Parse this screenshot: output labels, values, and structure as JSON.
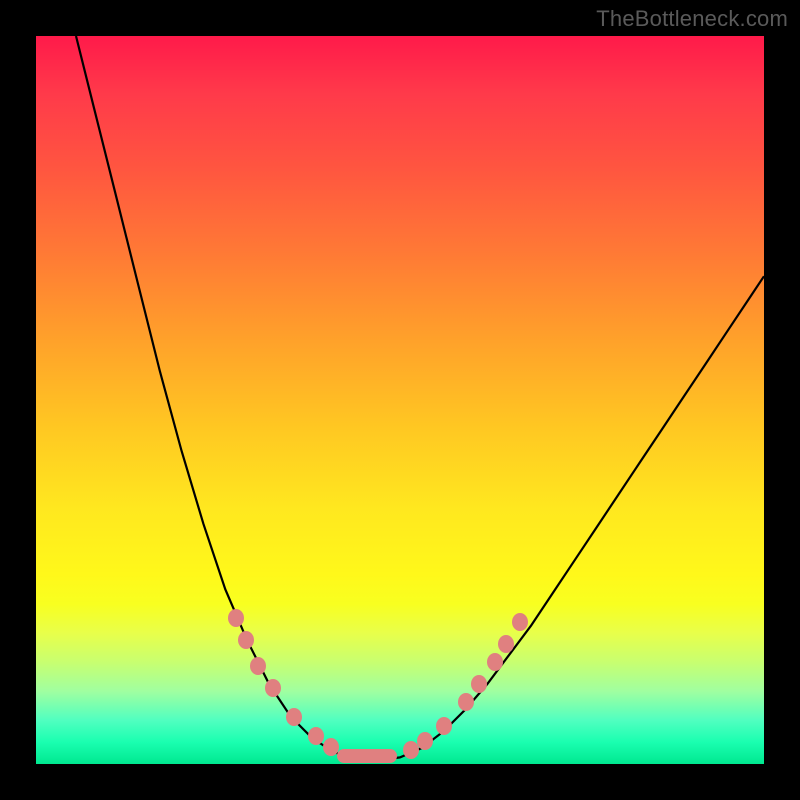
{
  "watermark": "TheBottleneck.com",
  "chart_data": {
    "type": "line",
    "title": "",
    "xlabel": "",
    "ylabel": "",
    "xlim": [
      0,
      100
    ],
    "ylim": [
      0,
      100
    ],
    "curve_points": [
      {
        "x": 5.5,
        "y": 100
      },
      {
        "x": 8,
        "y": 90
      },
      {
        "x": 11,
        "y": 78
      },
      {
        "x": 14,
        "y": 66
      },
      {
        "x": 17,
        "y": 54
      },
      {
        "x": 20,
        "y": 43
      },
      {
        "x": 23,
        "y": 33
      },
      {
        "x": 26,
        "y": 24
      },
      {
        "x": 29,
        "y": 17
      },
      {
        "x": 32,
        "y": 11
      },
      {
        "x": 35,
        "y": 6.5
      },
      {
        "x": 38,
        "y": 3.5
      },
      {
        "x": 41,
        "y": 1.6
      },
      {
        "x": 44,
        "y": 0.7
      },
      {
        "x": 47,
        "y": 0.5
      },
      {
        "x": 50,
        "y": 0.9
      },
      {
        "x": 53,
        "y": 2.2
      },
      {
        "x": 56,
        "y": 4.5
      },
      {
        "x": 59,
        "y": 7.5
      },
      {
        "x": 62,
        "y": 11
      },
      {
        "x": 65,
        "y": 15
      },
      {
        "x": 68,
        "y": 19
      },
      {
        "x": 71,
        "y": 23.5
      },
      {
        "x": 74,
        "y": 28
      },
      {
        "x": 77,
        "y": 32.5
      },
      {
        "x": 80,
        "y": 37
      },
      {
        "x": 83,
        "y": 41.5
      },
      {
        "x": 86,
        "y": 46
      },
      {
        "x": 89,
        "y": 50.5
      },
      {
        "x": 92,
        "y": 55
      },
      {
        "x": 95,
        "y": 59.5
      },
      {
        "x": 98,
        "y": 64
      },
      {
        "x": 100,
        "y": 67
      }
    ],
    "marker_points": [
      {
        "x": 27.5,
        "y": 20,
        "shape": "dot"
      },
      {
        "x": 28.8,
        "y": 17,
        "shape": "dot"
      },
      {
        "x": 30.5,
        "y": 13.5,
        "shape": "dot"
      },
      {
        "x": 32.5,
        "y": 10.5,
        "shape": "dot"
      },
      {
        "x": 35.5,
        "y": 6.5,
        "shape": "dot"
      },
      {
        "x": 38.5,
        "y": 3.8,
        "shape": "dot"
      },
      {
        "x": 40.5,
        "y": 2.4,
        "shape": "dot"
      },
      {
        "x": 45.5,
        "y": 1.1,
        "shape": "wide",
        "w": 60
      },
      {
        "x": 51.5,
        "y": 1.9,
        "shape": "dot"
      },
      {
        "x": 53.5,
        "y": 3.1,
        "shape": "dot"
      },
      {
        "x": 56,
        "y": 5.2,
        "shape": "dot"
      },
      {
        "x": 59,
        "y": 8.5,
        "shape": "dot"
      },
      {
        "x": 60.8,
        "y": 11,
        "shape": "dot"
      },
      {
        "x": 63,
        "y": 14,
        "shape": "dot"
      },
      {
        "x": 64.5,
        "y": 16.5,
        "shape": "dot"
      },
      {
        "x": 66.5,
        "y": 19.5,
        "shape": "dot"
      }
    ],
    "gradient_colors": {
      "top": "#ff1a4a",
      "mid": "#ffe81f",
      "bottom": "#00e890"
    }
  }
}
